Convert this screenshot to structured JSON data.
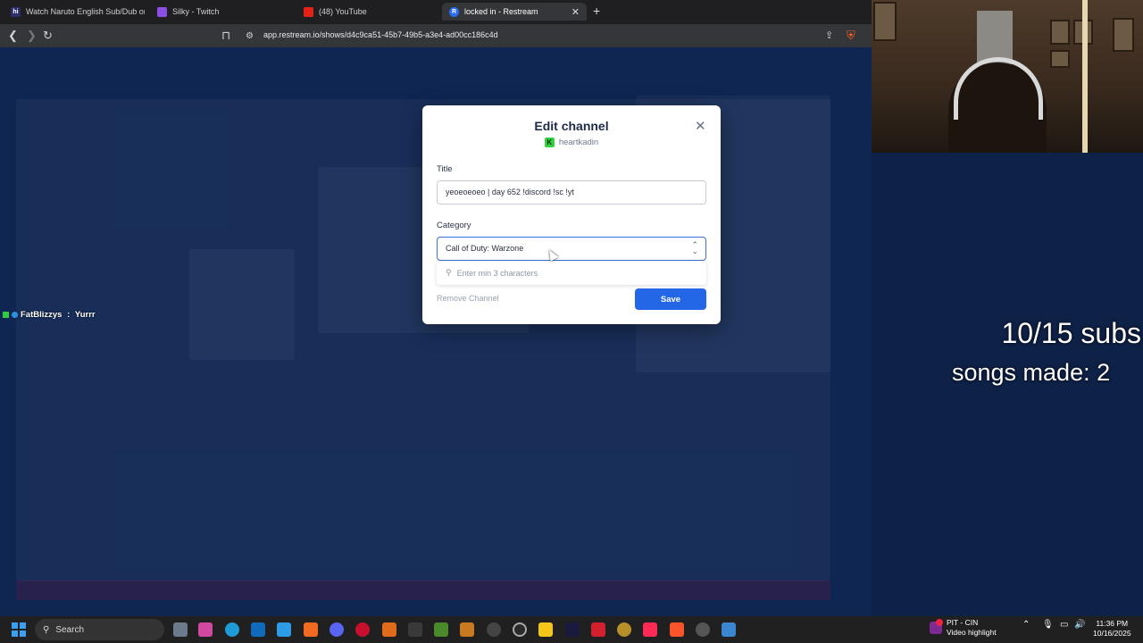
{
  "browser": {
    "tabs": [
      {
        "title": "Watch Naruto English Sub/Dub online",
        "fav": "hi",
        "color": "#2d2d6b",
        "active": false
      },
      {
        "title": "Silky - Twitch",
        "fav": "",
        "color": "#8b4fe3",
        "active": false
      },
      {
        "title": "(48) YouTube",
        "fav": "",
        "color": "#e62117",
        "active": false
      },
      {
        "title": "locked in - Restream",
        "fav": "R",
        "color": "#2a6cf2",
        "active": true
      }
    ],
    "url": "app.restream.io/shows/d4c9ca51-45b7-49b5-a3e4-ad00cc186c4d"
  },
  "overlay": {
    "chat_user": "FatBlizzys",
    "chat_sep": " : ",
    "chat_msg": "Yurrr",
    "subs": "10/15 subs",
    "songs": "songs made: 2"
  },
  "modal": {
    "title": "Edit channel",
    "channel_name": "heartkadin",
    "title_label": "Title",
    "title_value": "yeoeoeoeo | day 652 !discord !sc !yt",
    "category_label": "Category",
    "category_value": "Call of Duty: Warzone",
    "search_placeholder": "Enter min 3 characters",
    "remove_label": "Remove Channel",
    "save_label": "Save"
  },
  "taskbar": {
    "search_label": "Search",
    "notification_title": "PIT - CIN",
    "notification_sub": "Video highlight",
    "time": "11:36 PM",
    "date": "10/16/2025"
  }
}
